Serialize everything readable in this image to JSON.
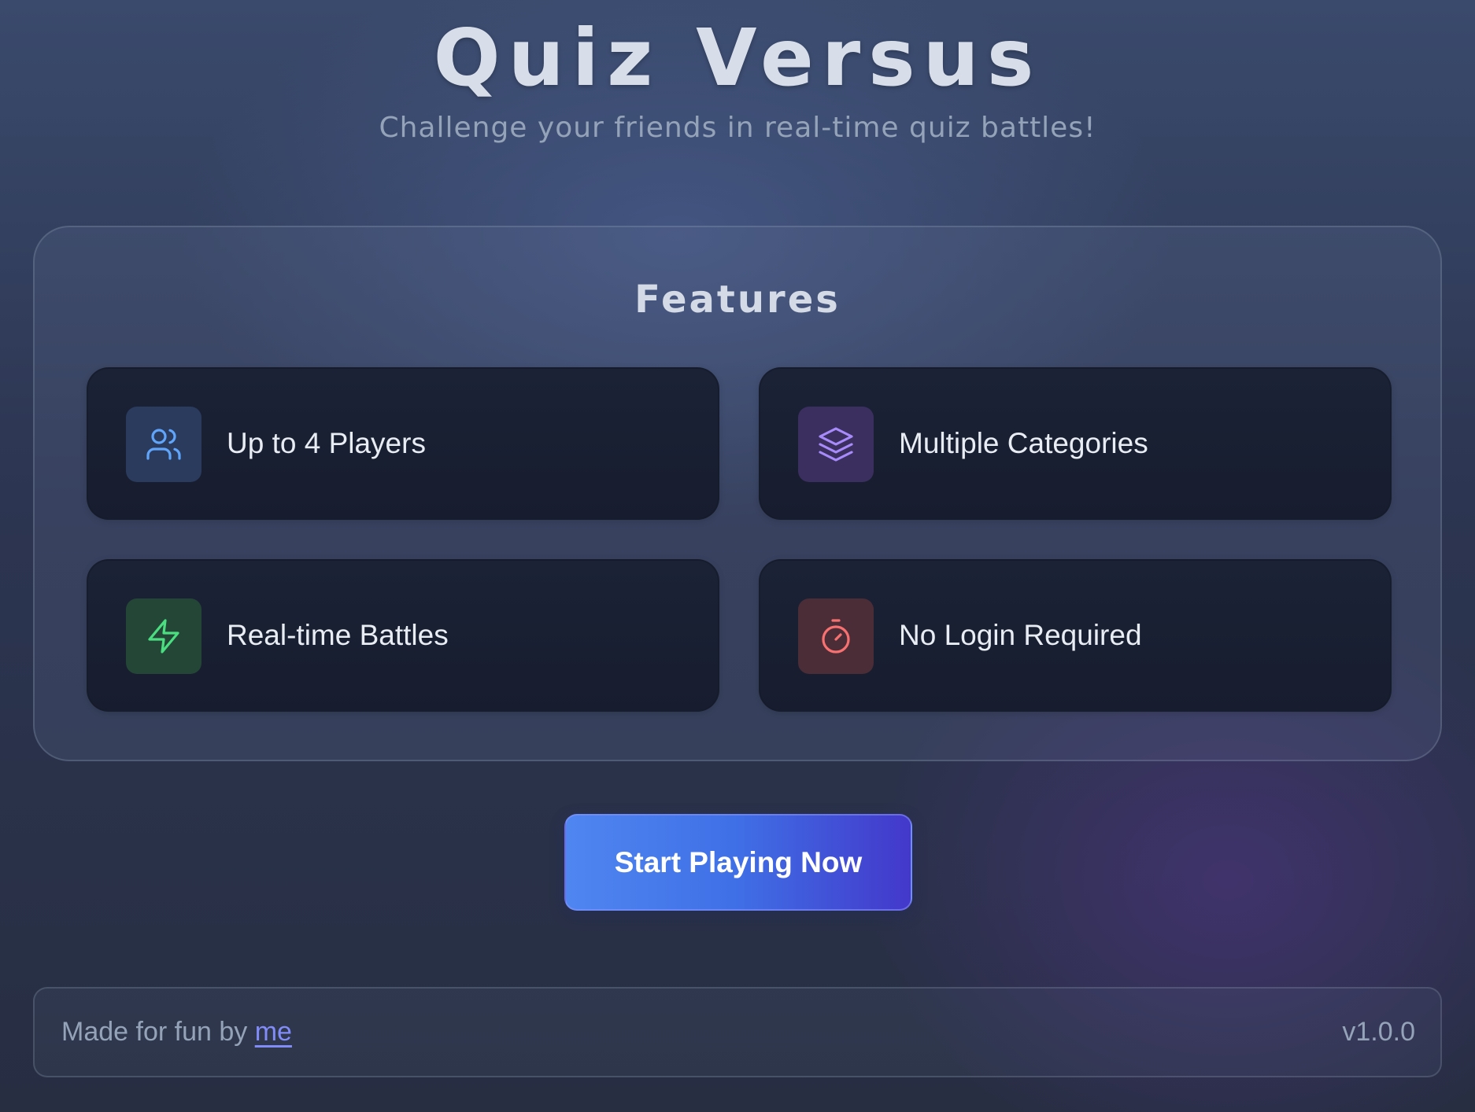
{
  "header": {
    "title": "Quiz Versus",
    "subtitle": "Challenge your friends in real-time quiz battles!"
  },
  "features": {
    "heading": "Features",
    "items": [
      {
        "label": "Up to 4 Players",
        "icon": "users-icon",
        "color": "#60a5fa",
        "bg": "#2a3b5e"
      },
      {
        "label": "Multiple Categories",
        "icon": "layers-icon",
        "color": "#a78bfa",
        "bg": "#3a2f5e"
      },
      {
        "label": "Real-time Battles",
        "icon": "lightning-icon",
        "color": "#4ade80",
        "bg": "#244636"
      },
      {
        "label": "No Login Required",
        "icon": "timer-icon",
        "color": "#f87171",
        "bg": "#4a2d36"
      }
    ]
  },
  "cta": {
    "label": "Start Playing Now"
  },
  "footer": {
    "prefix": "Made for fun by",
    "link": "me",
    "version": "v1.0.0"
  },
  "colors": {
    "accent": "#4f86f0",
    "accent_end": "#4338ca",
    "link": "#818cf8"
  }
}
